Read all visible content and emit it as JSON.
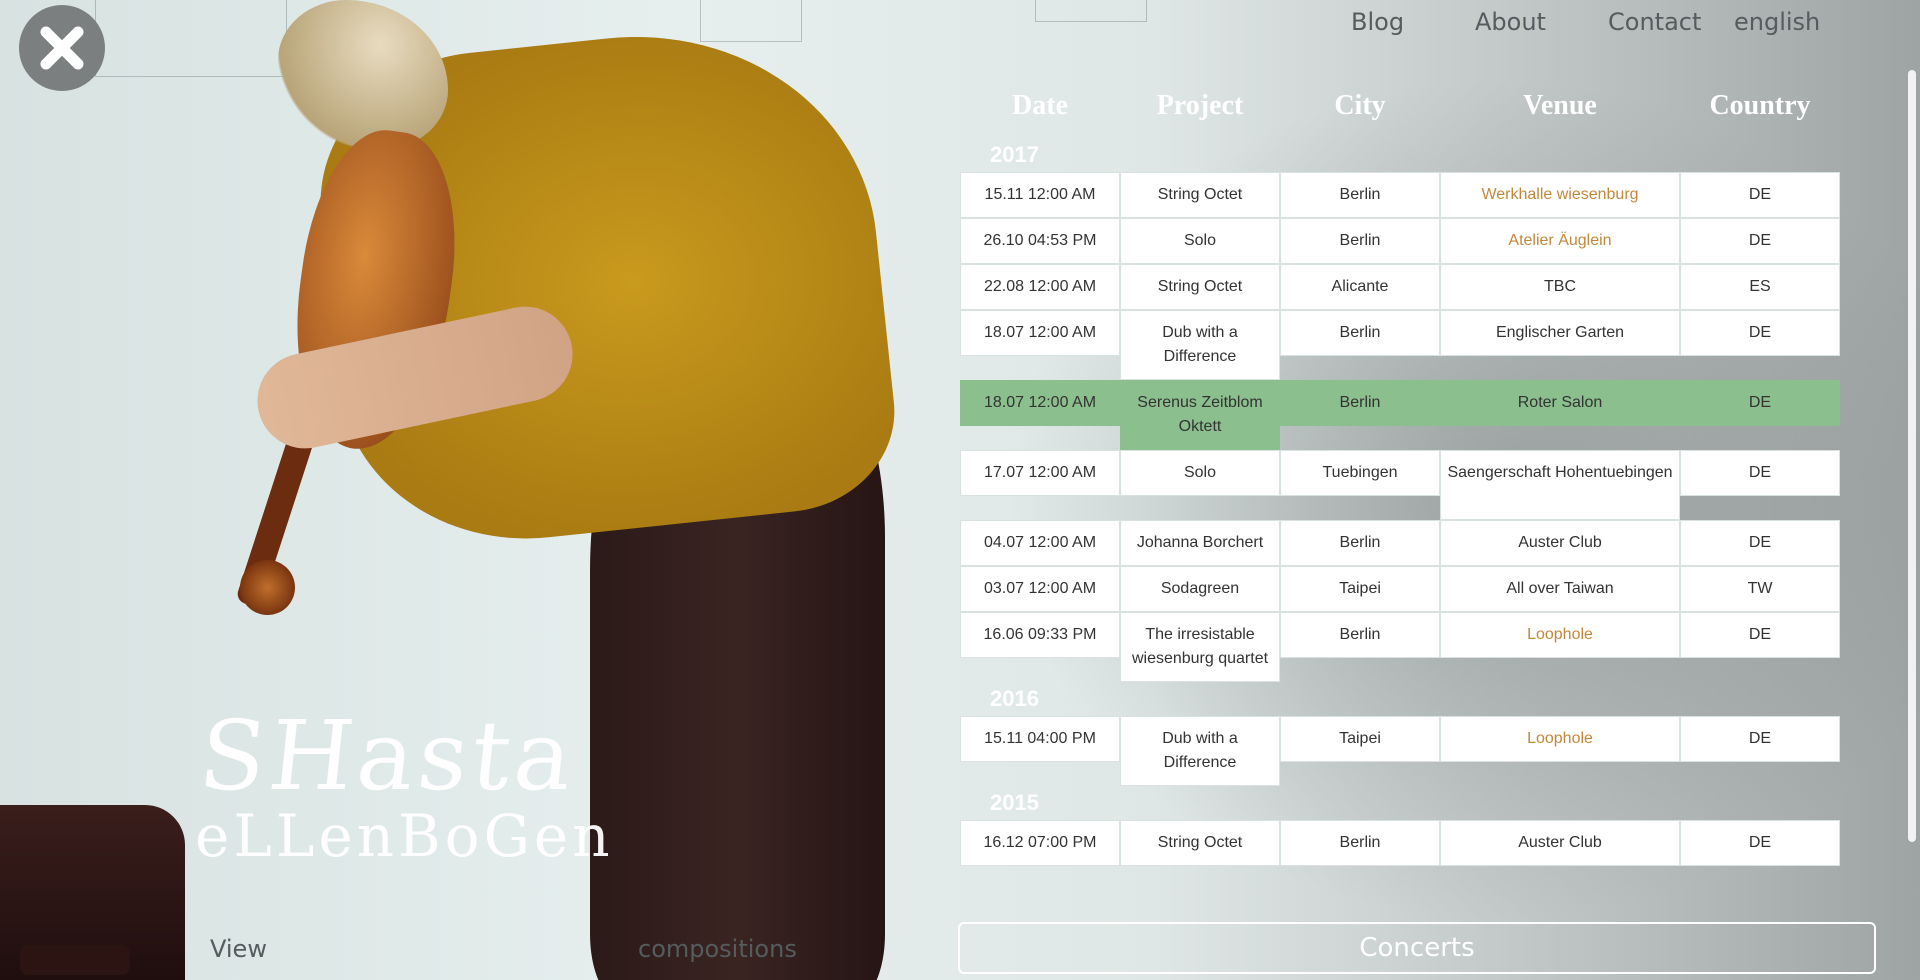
{
  "nav": {
    "blog": "Blog",
    "about": "About",
    "contact": "Contact",
    "language": "english"
  },
  "artist": {
    "signature_line1": "SHasta",
    "signature_line2": "eLLenBoGen"
  },
  "table": {
    "headers": {
      "date": "Date",
      "project": "Project",
      "city": "City",
      "venue": "Venue",
      "country": "Country"
    },
    "years": [
      {
        "year": "2017",
        "rows": [
          {
            "date": "15.11 12:00 AM",
            "project": "String Octet",
            "city": "Berlin",
            "venue": "Werkhalle wiesenburg",
            "country": "DE"
          },
          {
            "date": "26.10 04:53 PM",
            "project": "Solo",
            "city": "Berlin",
            "venue": "Atelier Äuglein",
            "country": "DE"
          },
          {
            "date": "22.08 12:00 AM",
            "project": "String Octet",
            "city": "Alicante",
            "venue": "TBC",
            "country": "ES"
          },
          {
            "date": "18.07 12:00 AM",
            "project": "Dub with a Difference",
            "city": "Berlin",
            "venue": "Englischer Garten",
            "country": "DE"
          },
          {
            "date": "18.07 12:00 AM",
            "project": "Serenus Zeitblom Oktett",
            "city": "Berlin",
            "venue": "Roter Salon",
            "country": "DE"
          },
          {
            "date": "17.07 12:00 AM",
            "project": "Solo",
            "city": "Tuebingen",
            "venue": "Saengerschaft Hohentuebingen",
            "country": "DE"
          },
          {
            "date": "04.07 12:00 AM",
            "project": "Johanna Borchert",
            "city": "Berlin",
            "venue": "Auster Club",
            "country": "DE"
          },
          {
            "date": "03.07 12:00 AM",
            "project": "Sodagreen",
            "city": "Taipei",
            "venue": "All over Taiwan",
            "country": "TW"
          },
          {
            "date": "16.06 09:33 PM",
            "project": "The irresistable wiesenburg quartet",
            "city": "Berlin",
            "venue": "Loophole",
            "country": "DE"
          }
        ]
      },
      {
        "year": "2016",
        "rows": [
          {
            "date": "15.11 04:00 PM",
            "project": "Dub with a Difference",
            "city": "Taipei",
            "venue": "Loophole",
            "country": "DE"
          }
        ]
      },
      {
        "year": "2015",
        "rows": [
          {
            "date": "16.12 07:00 PM",
            "project": "String Octet",
            "city": "Berlin",
            "venue": "Auster Club",
            "country": "DE"
          }
        ]
      }
    ]
  },
  "bottom": {
    "view": "View",
    "compositions": "compositions",
    "concerts": "Concerts"
  },
  "colors": {
    "highlight_row": "#8bbf8e",
    "venue_link": "#c0893a"
  }
}
